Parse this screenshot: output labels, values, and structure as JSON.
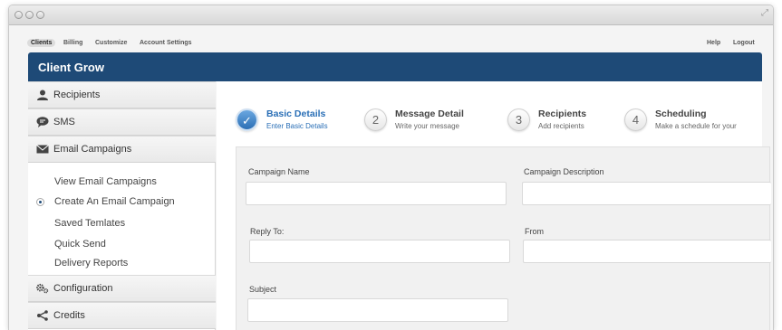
{
  "window": {
    "controls": [
      "close-dot",
      "minimize-dot",
      "zoom-dot"
    ],
    "resize_icon": "expand-arrows-icon"
  },
  "topnav": {
    "left_items": [
      "Clients",
      "Billing",
      "Customize",
      "Account Settings"
    ],
    "active_item": "Clients",
    "right_items": [
      "Help",
      "Logout"
    ]
  },
  "app": {
    "title": "Client Grow",
    "header_color": "#1e4a77"
  },
  "sidebar": {
    "sections": [
      {
        "label": "Recipients",
        "icon": "user-icon"
      },
      {
        "label": "SMS",
        "icon": "chat-bubble-icon"
      },
      {
        "label": "Email Campaigns",
        "icon": "envelope-icon"
      }
    ],
    "email_items": [
      {
        "label": "View Email Campaigns",
        "selected": false
      },
      {
        "label": "Create An Email Campaign",
        "selected": true
      },
      {
        "label": "Saved Temlates",
        "selected": false
      },
      {
        "label": "Quick Send",
        "selected": false
      },
      {
        "label": "Delivery Reports",
        "selected": false
      }
    ],
    "bottom_sections": [
      {
        "label": "Configuration",
        "icon": "gears-icon"
      },
      {
        "label": "Credits",
        "icon": "share-icon"
      }
    ]
  },
  "wizard": {
    "steps": [
      {
        "number": "✓",
        "title": "Basic Details",
        "subtitle": "Enter Basic Details",
        "active": true
      },
      {
        "number": "2",
        "title": "Message Detail",
        "subtitle": "Write your message",
        "active": false
      },
      {
        "number": "3",
        "title": "Recipients",
        "subtitle": "Add recipients",
        "active": false
      },
      {
        "number": "4",
        "title": "Scheduling",
        "subtitle": "Make a schedule for your",
        "active": false
      }
    ],
    "accent_color": "#2a6fb6"
  },
  "form": {
    "campaign_name": {
      "label": "Campaign Name",
      "value": ""
    },
    "campaign_description": {
      "label": "Campaign Description",
      "value": ""
    },
    "reply_to": {
      "label": "Reply To:",
      "value": ""
    },
    "from": {
      "label": "From",
      "value": ""
    },
    "subject": {
      "label": "Subject",
      "value": ""
    }
  }
}
